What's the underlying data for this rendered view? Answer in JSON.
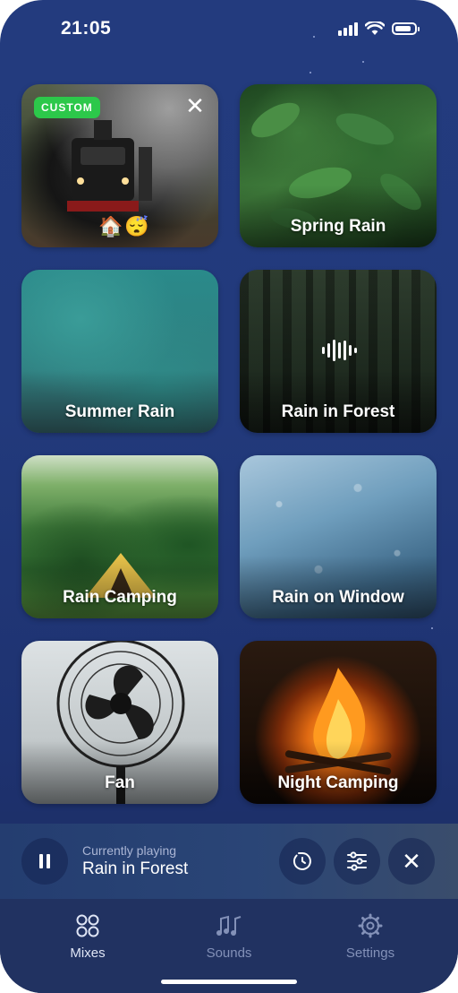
{
  "status": {
    "time": "21:05"
  },
  "cards": [
    {
      "label": "",
      "badge": "CUSTOM",
      "emojis": "🏠😴"
    },
    {
      "label": "Spring Rain"
    },
    {
      "label": "Summer Rain"
    },
    {
      "label": "Rain in Forest"
    },
    {
      "label": "Rain Camping"
    },
    {
      "label": "Rain on Window"
    },
    {
      "label": "Fan"
    },
    {
      "label": "Night Camping"
    }
  ],
  "player": {
    "caption": "Currently playing",
    "title": "Rain in Forest"
  },
  "tabs": [
    {
      "label": "Mixes",
      "icon": "mixes-icon",
      "active": true
    },
    {
      "label": "Sounds",
      "icon": "music-notes-icon",
      "active": false
    },
    {
      "label": "Settings",
      "icon": "gear-icon",
      "active": false
    }
  ],
  "colors": {
    "accent_badge": "#2cc84a",
    "background": "#233b7e"
  }
}
